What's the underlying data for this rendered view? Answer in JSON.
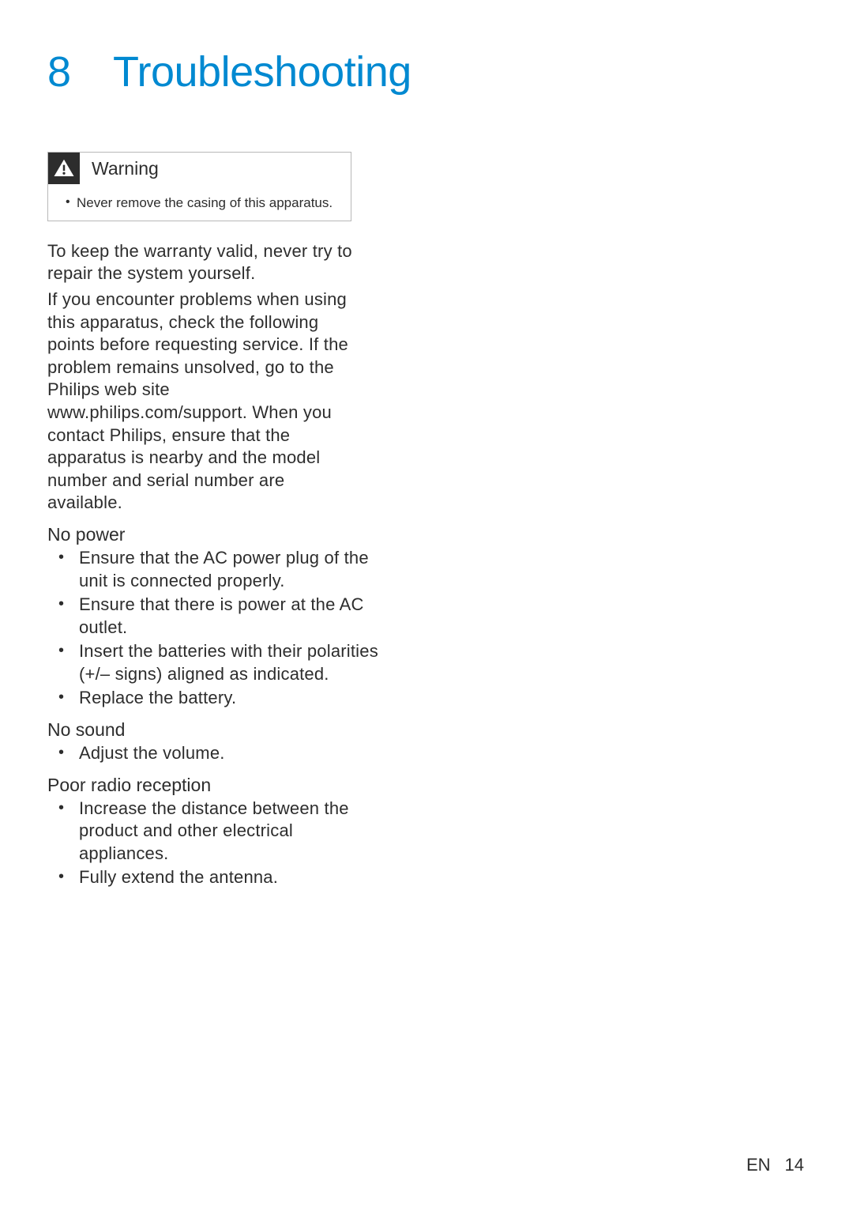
{
  "heading": "8 Troubleshooting",
  "warning": {
    "title": "Warning",
    "items": [
      "Never remove the casing of this apparatus."
    ]
  },
  "intro": [
    "To keep the warranty valid, never try to repair the system yourself.",
    "If you encounter problems when using this apparatus, check the following points before requesting service. If the problem remains unsolved, go to the Philips web site www.philips.com/support. When you contact Philips, ensure that the apparatus is nearby and the model number and serial number are available."
  ],
  "sections": [
    {
      "title": "No power",
      "items": [
        "Ensure that the AC power plug of the unit is connected properly.",
        "Ensure that there is power at the AC outlet.",
        "Insert the batteries with their polarities (+/– signs) aligned as indicated.",
        "Replace the battery."
      ]
    },
    {
      "title": "No sound",
      "items": [
        "Adjust the volume."
      ]
    },
    {
      "title": "Poor radio reception",
      "items": [
        "Increase the distance between the product and other electrical appliances.",
        "Fully extend the antenna."
      ]
    }
  ],
  "footer": {
    "lang": "EN",
    "page": "14"
  }
}
